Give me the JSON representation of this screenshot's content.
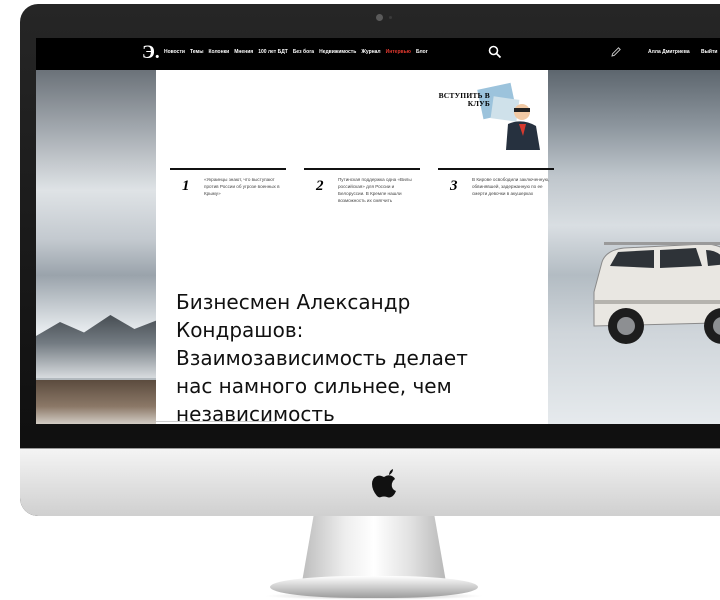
{
  "nav": {
    "brand": "Э.",
    "links": [
      "Новости",
      "Темы",
      "Колонки",
      "Мнения",
      "100 лет БДТ",
      "Без бога",
      "Недвижимость",
      "Журнал",
      "Интервью",
      "Блог"
    ],
    "active_link": "Интервью",
    "user_name": "Алла Дмитриева",
    "logout_label": "Выйти",
    "icons": {
      "search": "search-icon",
      "pencil": "pencil-icon"
    }
  },
  "promo": {
    "text": "ВСТУПИТЬ В КЛУБ"
  },
  "news": [
    {
      "number": "1",
      "text": "«Украинцы знают, что выступают против России об угрозе военных в Крыму»"
    },
    {
      "number": "2",
      "text": "Путинская поддержка одна «Вилы российская» для России и Белоруссии. В Кремле нашли возможность их смягчить"
    },
    {
      "number": "3",
      "text": "В Кирове освободили заключенную, обвинявшей, задержанную по ее смерти девочки в акушерках"
    }
  ],
  "headline": "Бизнесмен Александр Кондрашов: Взаимозависимость делает нас намного сильнее, чем независимость",
  "colors": {
    "nav_bg": "#000000",
    "active_link": "#e3392f",
    "monitor_bezel": "#1a1a1a",
    "article_bg": "#ffffff"
  },
  "device": {
    "logo": "apple-logo-icon"
  }
}
